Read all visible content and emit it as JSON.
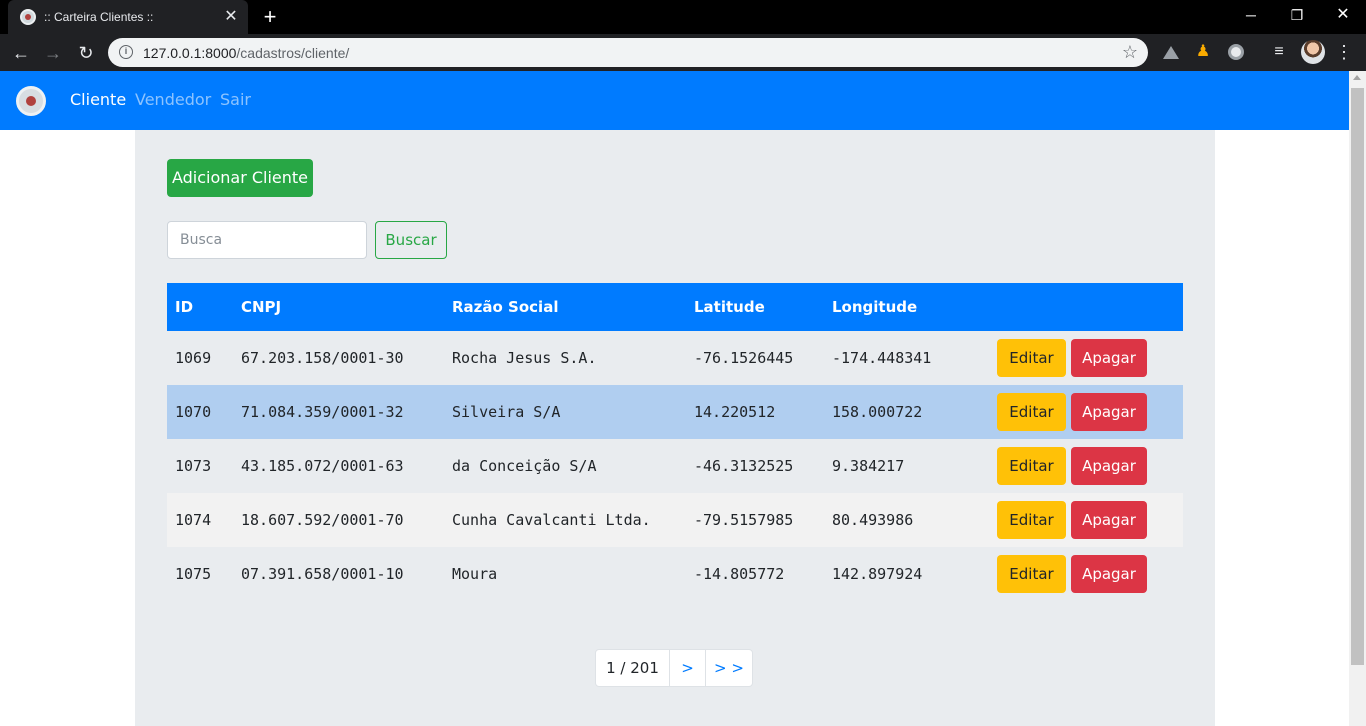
{
  "browser": {
    "tab_title": ":: Carteira Clientes ::",
    "tab_close": "✕",
    "new_tab": "+",
    "window_controls": {
      "minimize": "─",
      "maximize": "❐",
      "close": "✕"
    },
    "url_host": "127.0.0.1:8000",
    "url_path": "/cadastros/cliente/"
  },
  "navbar": {
    "links": [
      "Cliente",
      "Vendedor",
      "Sair"
    ],
    "active": "Cliente",
    "color": "#007bff"
  },
  "actions": {
    "add_label": "Adicionar Cliente",
    "search_placeholder": "Busca",
    "search_button": "Buscar"
  },
  "table": {
    "headers": [
      "ID",
      "CNPJ",
      "Razão Social",
      "Latitude",
      "Longitude"
    ],
    "rows": [
      {
        "id": "1069",
        "cnpj": "67.203.158/0001-30",
        "razao": "Rocha Jesus S.A.",
        "lat": "-76.1526445",
        "lon": "-174.448341",
        "bg": "#e9ecef"
      },
      {
        "id": "1070",
        "cnpj": "71.084.359/0001-32",
        "razao": "Silveira S/A",
        "lat": "14.220512",
        "lon": "158.000722",
        "bg": "#b0cef0"
      },
      {
        "id": "1073",
        "cnpj": "43.185.072/0001-63",
        "razao": "da Conceição S/A",
        "lat": "-46.3132525",
        "lon": "9.384217",
        "bg": "#e9ecef"
      },
      {
        "id": "1074",
        "cnpj": "18.607.592/0001-70",
        "razao": "Cunha Cavalcanti Ltda.",
        "lat": "-79.5157985",
        "lon": "80.493986",
        "bg": "#f2f2f2"
      },
      {
        "id": "1075",
        "cnpj": "07.391.658/0001-10",
        "razao": "Moura",
        "lat": "-14.805772",
        "lon": "142.897924",
        "bg": "#e9ecef"
      }
    ],
    "edit_label": "Editar",
    "delete_label": "Apagar"
  },
  "pagination": {
    "current": "1 / 201",
    "next": ">",
    "last": "> >"
  },
  "colors": {
    "primary": "#007bff",
    "success": "#28a745",
    "warning": "#ffc107",
    "danger": "#dc3545"
  }
}
